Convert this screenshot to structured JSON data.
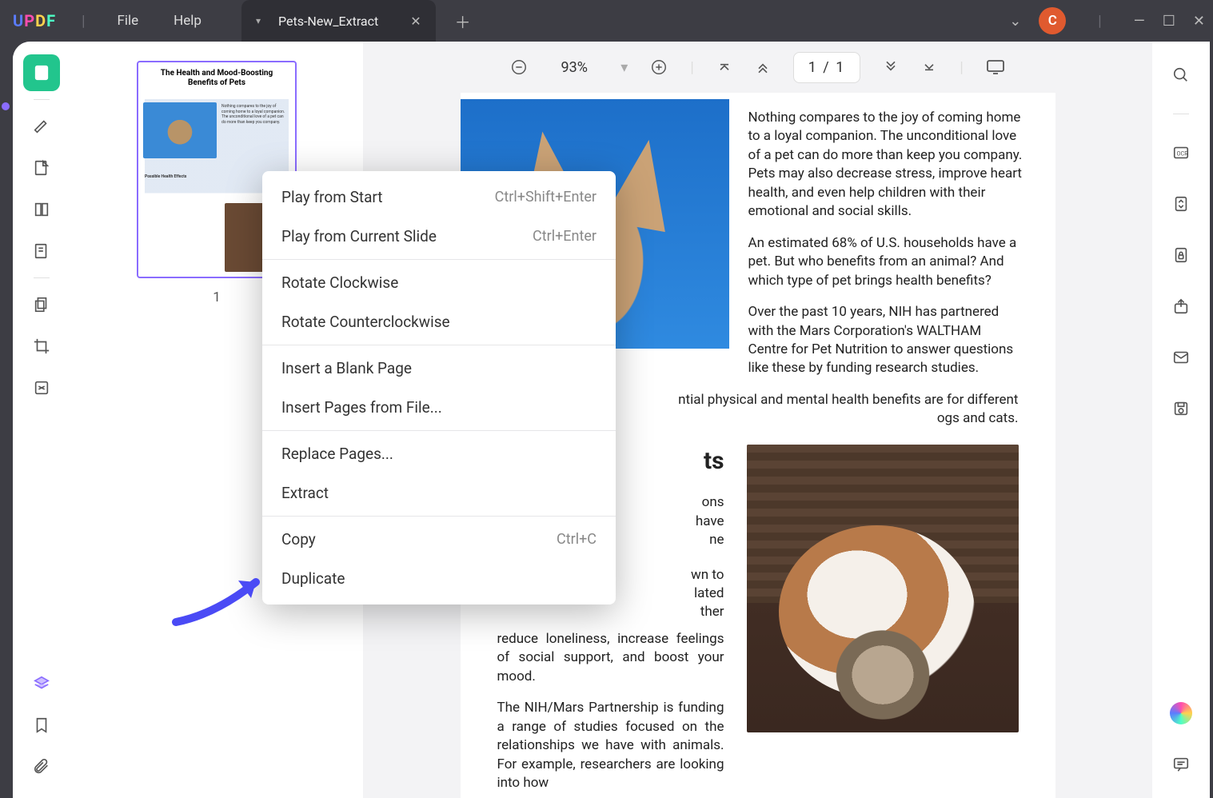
{
  "titlebar": {
    "logo": "UPDF",
    "menu_file": "File",
    "menu_help": "Help",
    "tab_title": "Pets-New_Extract",
    "avatar_letter": "C"
  },
  "toolbar": {
    "zoom_value": "93%",
    "page_indicator": "1  /  1"
  },
  "thumbnail": {
    "title": "The Health and Mood-Boosting Benefits of Pets",
    "number": "1"
  },
  "document": {
    "p1": "Nothing compares to the joy of coming home to a loyal companion. The unconditional love of a pet can do more than keep you company. Pets may also decrease stress, improve heart health,  and  even  help children  with  their emotional and social skills.",
    "p2": "An estimated 68% of U.S. households have a pet. But who benefits from an animal? And which type of pet brings health benefits?",
    "p3": "Over  the  past  10  years,  NIH  has partnered with the Mars Corporation's WALTHAM Centre for  Pet  Nutrition  to answer  questions  like these by funding research studies.",
    "p4_frag": "ntial physical and mental health benefits are for different",
    "p5_frag": "ogs and cats.",
    "h2_frag": "ts",
    "p6a": "ons",
    "p6b": "have",
    "p6c": "ne",
    "p7a": "wn to",
    "p7b": "lated",
    "p7c": "ther",
    "p8": "reduce loneliness,  increase  feelings  of social support, and boost your mood.",
    "p9": "The  NIH/Mars  Partnership  is  funding  a range  of  studies  focused  on  the relationships  we  have  with  animals.  For example, researchers are looking into how"
  },
  "context_menu": {
    "items": [
      {
        "label": "Play from Start",
        "shortcut": "Ctrl+Shift+Enter"
      },
      {
        "label": "Play from Current Slide",
        "shortcut": "Ctrl+Enter"
      },
      {
        "label": "Rotate Clockwise",
        "shortcut": ""
      },
      {
        "label": "Rotate Counterclockwise",
        "shortcut": ""
      },
      {
        "label": "Insert a Blank Page",
        "shortcut": ""
      },
      {
        "label": "Insert Pages from File...",
        "shortcut": ""
      },
      {
        "label": "Replace Pages...",
        "shortcut": ""
      },
      {
        "label": "Extract",
        "shortcut": ""
      },
      {
        "label": "Copy",
        "shortcut": "Ctrl+C"
      },
      {
        "label": "Duplicate",
        "shortcut": ""
      }
    ]
  }
}
